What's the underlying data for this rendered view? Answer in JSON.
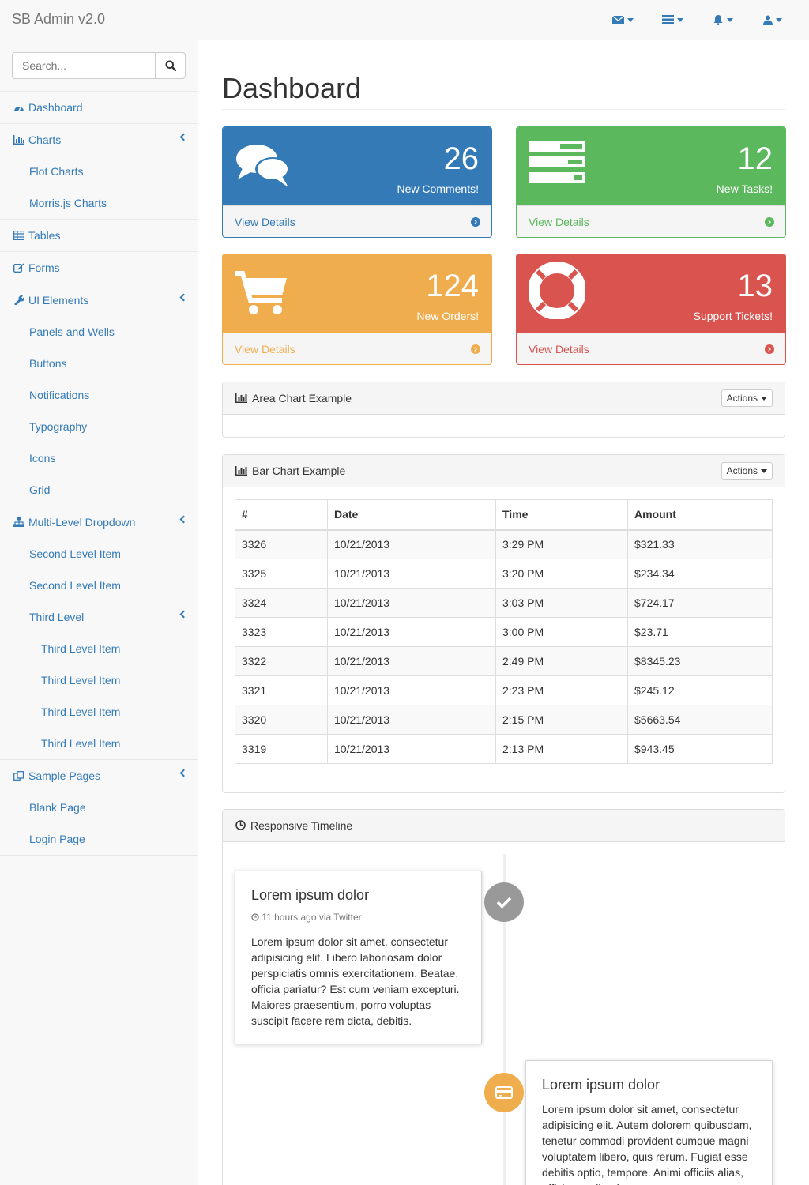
{
  "topbar": {
    "brand": "SB Admin v2.0",
    "icons": [
      "envelope-icon",
      "tasks-icon",
      "bell-icon",
      "user-icon"
    ]
  },
  "sidebar": {
    "search_placeholder": "Search...",
    "items": [
      {
        "label": "Dashboard",
        "icon": "dashboard-icon"
      },
      {
        "label": "Charts",
        "icon": "bar-chart-icon"
      },
      {
        "label": "Flot Charts"
      },
      {
        "label": "Morris.js Charts"
      },
      {
        "label": "Tables",
        "icon": "table-icon"
      },
      {
        "label": "Forms",
        "icon": "edit-icon"
      },
      {
        "label": "UI Elements",
        "icon": "wrench-icon"
      },
      {
        "label": "Panels and Wells"
      },
      {
        "label": "Buttons"
      },
      {
        "label": "Notifications"
      },
      {
        "label": "Typography"
      },
      {
        "label": "Icons"
      },
      {
        "label": "Grid"
      },
      {
        "label": "Multi-Level Dropdown",
        "icon": "sitemap-icon"
      },
      {
        "label": "Second Level Item"
      },
      {
        "label": "Second Level Item"
      },
      {
        "label": "Third Level"
      },
      {
        "label": "Third Level Item"
      },
      {
        "label": "Third Level Item"
      },
      {
        "label": "Third Level Item"
      },
      {
        "label": "Third Level Item"
      },
      {
        "label": "Sample Pages",
        "icon": "files-icon"
      },
      {
        "label": "Blank Page"
      },
      {
        "label": "Login Page"
      }
    ]
  },
  "main": {
    "title": "Dashboard",
    "stats": [
      {
        "value": "26",
        "label": "New Comments!",
        "footer": "View Details",
        "color": "#337ab7",
        "icon": "comments-icon"
      },
      {
        "value": "12",
        "label": "New Tasks!",
        "footer": "View Details",
        "color": "#5cb85c",
        "icon": "tasks-icon"
      },
      {
        "value": "124",
        "label": "New Orders!",
        "footer": "View Details",
        "color": "#f0ad4e",
        "icon": "shopping-cart-icon"
      },
      {
        "value": "13",
        "label": "Support Tickets!",
        "footer": "View Details",
        "color": "#d9534f",
        "icon": "life-ring-icon"
      }
    ],
    "area_panel": {
      "title": "Area Chart Example",
      "actions": "Actions"
    },
    "bar_panel": {
      "title": "Bar Chart Example",
      "actions": "Actions"
    },
    "table": {
      "headers": [
        "#",
        "Date",
        "Time",
        "Amount"
      ],
      "rows": [
        [
          "3326",
          "10/21/2013",
          "3:29 PM",
          "$321.33"
        ],
        [
          "3325",
          "10/21/2013",
          "3:20 PM",
          "$234.34"
        ],
        [
          "3324",
          "10/21/2013",
          "3:03 PM",
          "$724.17"
        ],
        [
          "3323",
          "10/21/2013",
          "3:00 PM",
          "$23.71"
        ],
        [
          "3322",
          "10/21/2013",
          "2:49 PM",
          "$8345.23"
        ],
        [
          "3321",
          "10/21/2013",
          "2:23 PM",
          "$245.12"
        ],
        [
          "3320",
          "10/21/2013",
          "2:15 PM",
          "$5663.54"
        ],
        [
          "3319",
          "10/21/2013",
          "2:13 PM",
          "$943.45"
        ]
      ]
    },
    "timeline": {
      "title": "Responsive Timeline",
      "entries": [
        {
          "title": "Lorem ipsum dolor",
          "meta": "11 hours ago via Twitter",
          "body": "Lorem ipsum dolor sit amet, consectetur adipisicing elit. Libero laboriosam dolor perspiciatis omnis exercitationem. Beatae, officia pariatur? Est cum veniam excepturi. Maiores praesentium, porro voluptas suscipit facere rem dicta, debitis.",
          "badge_color": "#999999",
          "badge_icon": "check-icon"
        },
        {
          "title": "Lorem ipsum dolor",
          "body": "Lorem ipsum dolor sit amet, consectetur adipisicing elit. Autem dolorem quibusdam, tenetur commodi provident cumque magni voluptatem libero, quis rerum. Fugiat esse debitis optio, tempore. Animi officiis alias, officia repellendus.",
          "badge_color": "#f0ad4e",
          "badge_icon": "credit-card-icon"
        }
      ]
    }
  }
}
